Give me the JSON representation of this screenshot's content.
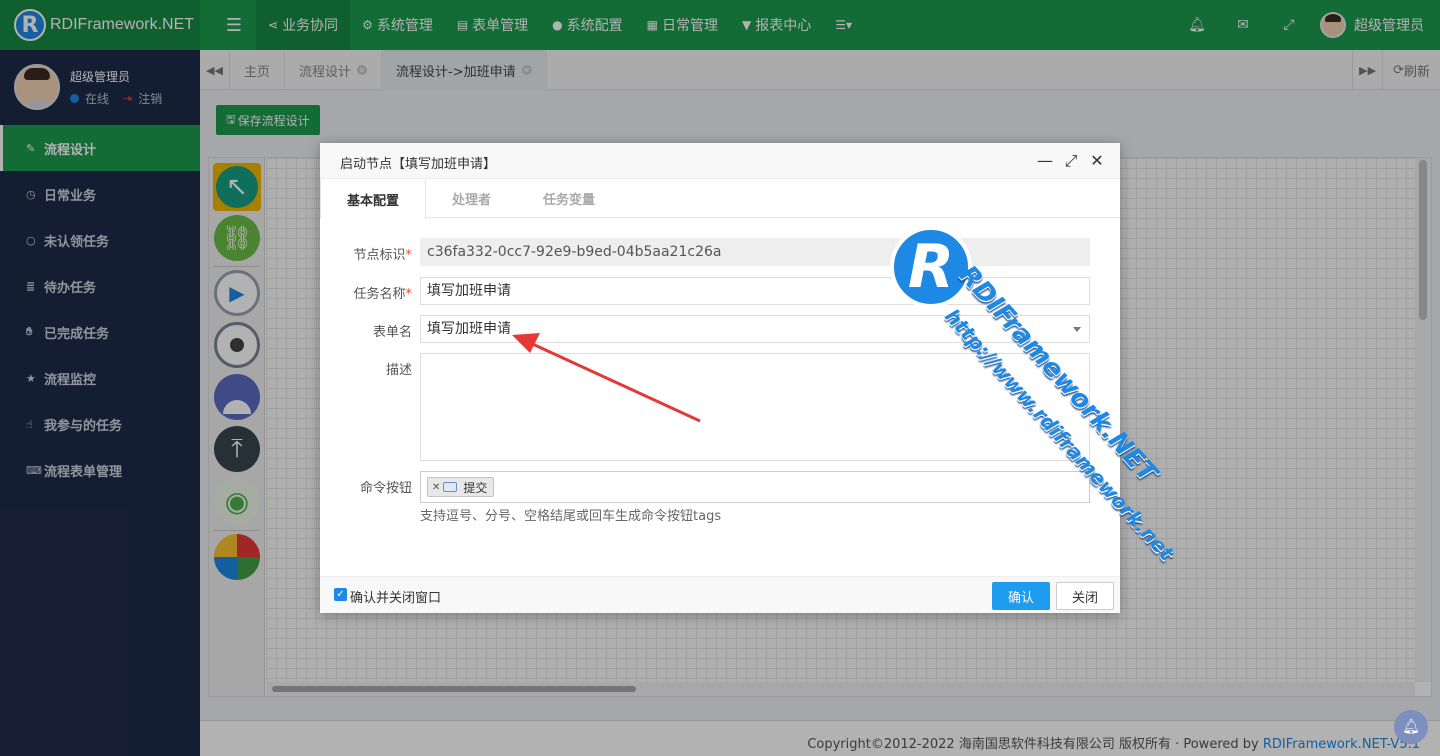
{
  "app": {
    "logo_letter": "R",
    "title": "RDIFramework.NET"
  },
  "topnav": [
    {
      "icon": "share-icon",
      "label": "业务协同",
      "active": true
    },
    {
      "icon": "cogs-icon",
      "label": "系统管理",
      "active": false
    },
    {
      "icon": "form-icon",
      "label": "表单管理",
      "active": false
    },
    {
      "icon": "circle-icon",
      "label": "系统配置",
      "active": false
    },
    {
      "icon": "calendar-icon",
      "label": "日常管理",
      "active": false
    },
    {
      "icon": "filter-icon",
      "label": "报表中心",
      "active": false
    },
    {
      "icon": "list-icon",
      "label": ""
    }
  ],
  "topright": {
    "user_name": "超级管理员"
  },
  "user_panel": {
    "name": "超级管理员",
    "status": "在线",
    "logout": "注销"
  },
  "sidebar": {
    "items": [
      {
        "icon": "edit-icon",
        "label": "流程设计",
        "active": true
      },
      {
        "icon": "clock-icon",
        "label": "日常业务"
      },
      {
        "icon": "circle-o-icon",
        "label": "未认领任务"
      },
      {
        "icon": "tasks-icon",
        "label": "待办任务"
      },
      {
        "icon": "hand-icon",
        "label": "已完成任务"
      },
      {
        "icon": "star-icon",
        "label": "流程监控"
      },
      {
        "icon": "hand-pointer-icon",
        "label": "我参与的任务"
      },
      {
        "icon": "keyboard-icon",
        "label": "流程表单管理"
      }
    ]
  },
  "tabs": [
    {
      "label": "主页",
      "closable": false
    },
    {
      "label": "流程设计",
      "closable": true
    },
    {
      "label": "流程设计->加班申请",
      "closable": true,
      "active": true
    }
  ],
  "tabbar": {
    "refresh": "刷新"
  },
  "toolbar": {
    "save_label": "保存流程设计"
  },
  "dialog": {
    "title": "启动节点【填写加班申请】",
    "tabs": [
      "基本配置",
      "处理者",
      "任务变量"
    ],
    "fields": {
      "node_id_label": "节点标识",
      "node_id_value": "c36fa332-0cc7-92e9-b9ed-04b5aa21c26a",
      "task_name_label": "任务名称",
      "task_name_value": "填写加班申请",
      "form_label": "表单名",
      "form_value": "填写加班申请",
      "desc_label": "描述",
      "desc_value": "",
      "cmd_label": "命令按钮",
      "cmd_tag": "提交",
      "cmd_help": "支持逗号、分号、空格结尾或回车生成命令按钮tags"
    },
    "footer": {
      "checkbox_label": "确认并关闭窗口",
      "checked": true,
      "ok": "确认",
      "close": "关闭"
    }
  },
  "footer": {
    "copyright": "Copyright©2012-2022 海南国思软件科技有限公司 版权所有 · Powered by ",
    "link": "RDIFramework.NET-V5.1"
  },
  "watermark": {
    "text1": "RDIFramework.NET",
    "text2": "http://www.rdiframework.net"
  }
}
